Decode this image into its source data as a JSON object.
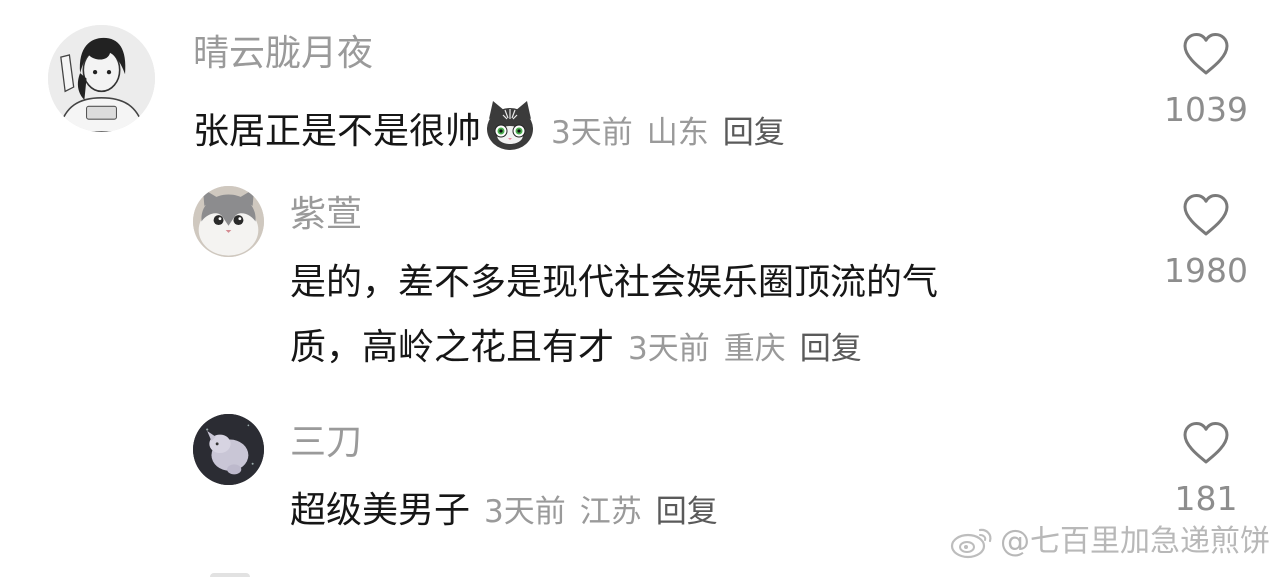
{
  "comments": [
    {
      "username": "晴云胧月夜",
      "text": "张居正是不是很帅",
      "emoji": "cat-emoji",
      "time": "3天前",
      "location": "山东",
      "reply": "回复",
      "likes": "1039"
    },
    {
      "username": "紫萱",
      "text_line1": "是的，差不多是现代社会娱乐圈顶流的气",
      "text_line2": "质，高岭之花且有才",
      "time": "3天前",
      "location": "重庆",
      "reply": "回复",
      "likes": "1980"
    },
    {
      "username": "三刀",
      "text": "超级美男子",
      "time": "3天前",
      "location": "江苏",
      "reply": "回复",
      "likes": "181"
    }
  ],
  "watermark": "@七百里加急递煎饼",
  "icons": {
    "like": "heart-outline-icon",
    "watermark": "weibo-logo"
  }
}
